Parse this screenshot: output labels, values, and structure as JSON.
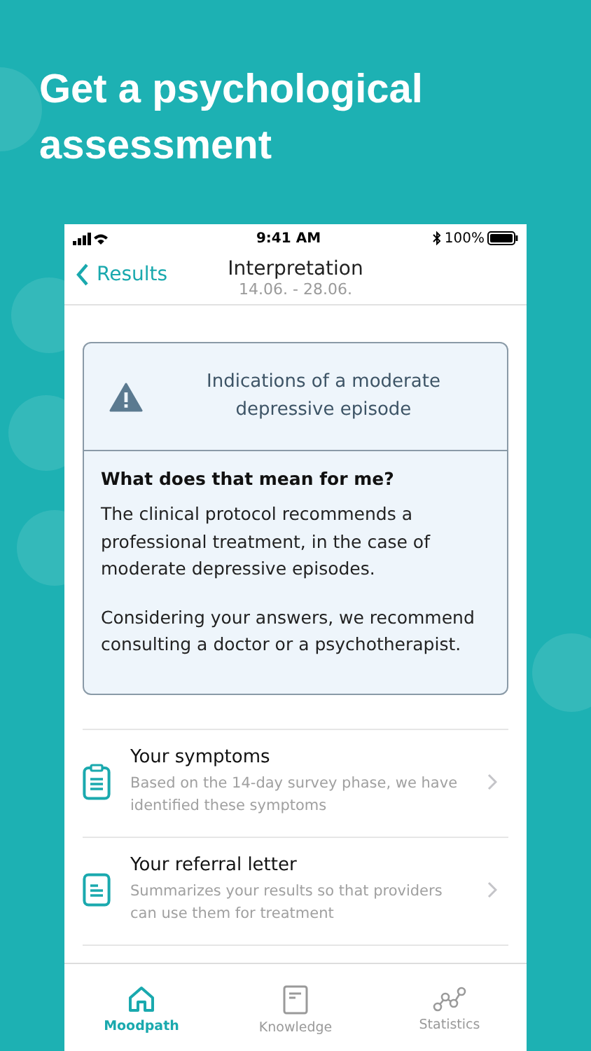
{
  "headline": "Get a psychological assessment",
  "status_bar": {
    "time": "9:41 AM",
    "battery": "100%"
  },
  "nav": {
    "back": "Results",
    "title": "Interpretation",
    "subtitle": "14.06. - 28.06."
  },
  "result_card": {
    "diagnosis": "Indications of a moderate depressive episode",
    "question": "What does that mean for me?",
    "paragraphs": [
      "The clinical protocol recommends a professional treatment, in the case of moderate depressive episodes.",
      "Considering your answers, we recommend consulting a doctor or a psychotherapist."
    ]
  },
  "items": [
    {
      "kind": "clipboard",
      "title": "Your symptoms",
      "description": "Based on the 14-day survey phase, we have identified these symptoms"
    },
    {
      "kind": "document",
      "title": "Your referral letter",
      "description": "Summarizes your results so that providers can use them for treatment"
    }
  ],
  "tabs": [
    {
      "kind": "home",
      "label": "Moodpath",
      "selected": true
    },
    {
      "kind": "book",
      "label": "Knowledge",
      "selected": false
    },
    {
      "kind": "chart",
      "label": "Statistics",
      "selected": false
    }
  ]
}
